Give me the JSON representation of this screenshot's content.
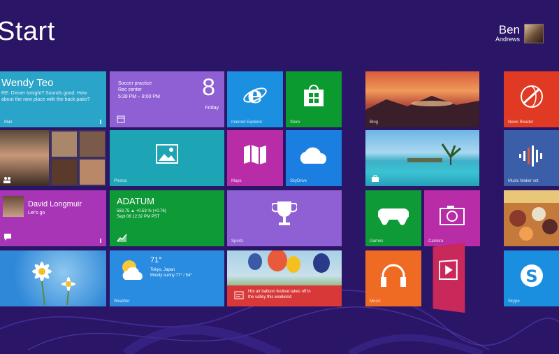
{
  "header": {
    "title": "Start",
    "user_first": "Ben",
    "user_last": "Andrews"
  },
  "tiles": {
    "mail": {
      "from": "Wendy Teo",
      "body": "RE: Dinner tonight? Sounds good. How about the new place with the back patio?",
      "label": "Mail"
    },
    "calendar": {
      "event": "Soccer practice",
      "location": "Rec center",
      "time": "5:30 PM – 8:00 PM",
      "day": "8",
      "weekday": "Friday"
    },
    "ie": {
      "label": "Internet Explorer"
    },
    "store": {
      "label": "Store"
    },
    "bing": {
      "label": "Bing"
    },
    "news": {
      "label": "News Reader"
    },
    "photos": {
      "label": "Photos"
    },
    "maps": {
      "label": "Maps"
    },
    "skydrive": {
      "label": "SkyDrive"
    },
    "music": {
      "label": "Music Maker set"
    },
    "people": {
      "name": "David Longmuir",
      "message": "Let's go"
    },
    "finance": {
      "company": "ADATUM",
      "line1": "563.75 ▲ +0.53 % (+0.76)",
      "line2": "Sept 08 12:32 PM PST"
    },
    "games": {
      "label": "Sports"
    },
    "xbox": {
      "label": "Games"
    },
    "camera": {
      "label": "Camera"
    },
    "weather": {
      "temp": "71°",
      "city": "Tokyo, Japan",
      "cond": "Mostly sunny 77° / 54°",
      "label": "Weather"
    },
    "balloon": {
      "caption1": "Hot air balloon festival takes off in",
      "caption2": "the valley this weekend"
    },
    "headphones": {
      "label": "Music"
    },
    "skype": {
      "label": "Skype"
    }
  },
  "colors": {
    "background": "#2a1566",
    "accent_blue": "#1b8fe0",
    "accent_green": "#0b9a2f",
    "accent_purple": "#8f5fd4",
    "accent_magenta": "#b82ca8"
  }
}
